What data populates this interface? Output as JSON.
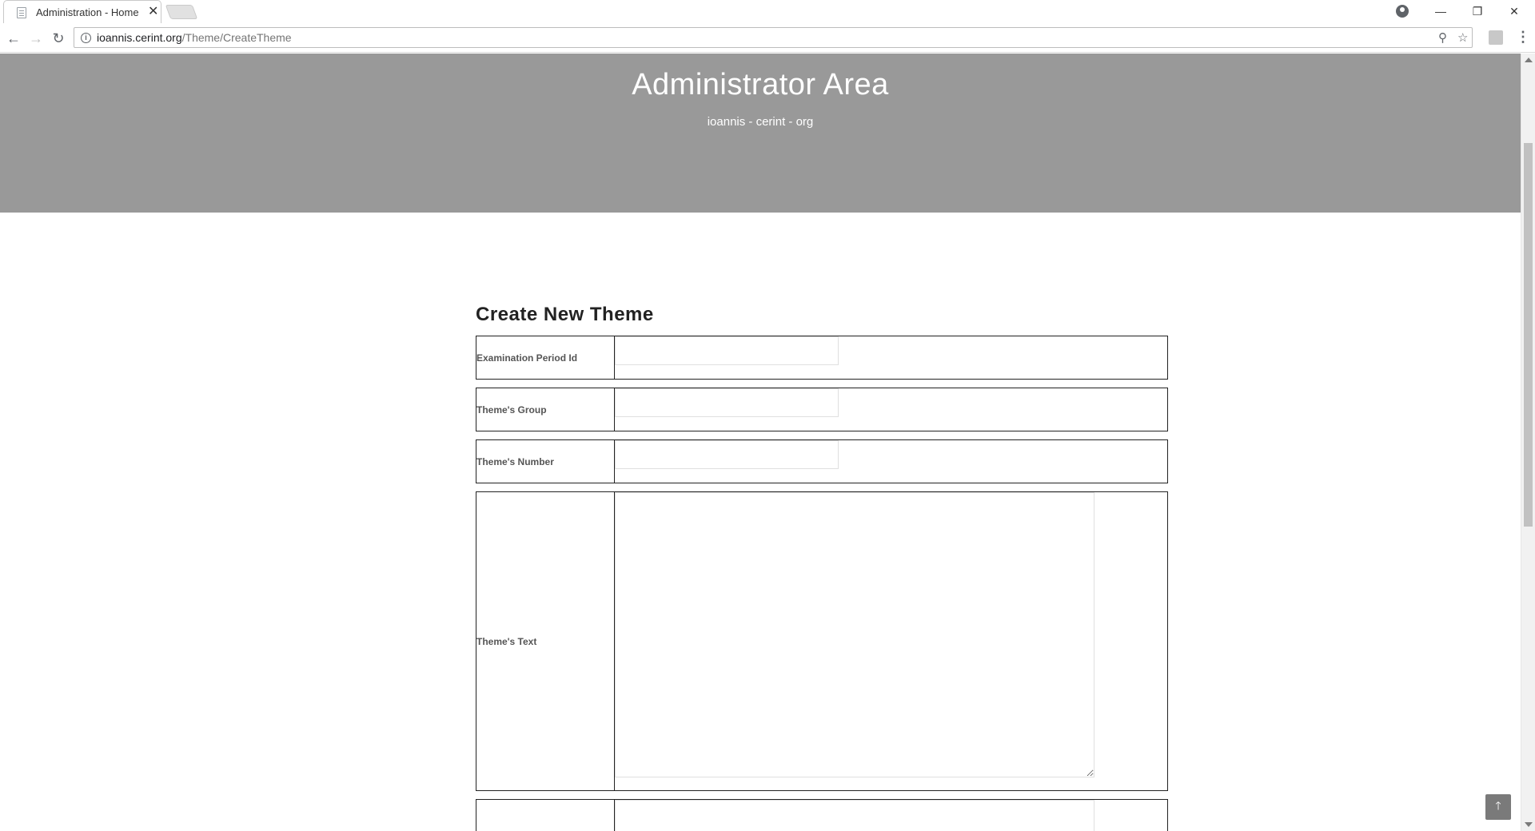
{
  "browser": {
    "tab_title": "Administration - Home -",
    "tab_close": "✕",
    "url_host": "ioannis.cerint.org",
    "url_path": "/Theme/CreateTheme",
    "window_controls": {
      "minimize": "—",
      "restore": "❐",
      "close": "✕"
    },
    "icons": [
      "back-icon",
      "forward-icon",
      "reload-icon",
      "info-icon",
      "zoom-icon",
      "star-icon",
      "profile-icon",
      "menu-icon"
    ]
  },
  "header": {
    "title": "Administrator Area",
    "subtitle": "ioannis - cerint - org"
  },
  "form": {
    "title": "Create New Theme",
    "fields": [
      {
        "label": "Examination Period Id",
        "value": ""
      },
      {
        "label": "Theme's Group",
        "value": ""
      },
      {
        "label": "Theme's Number",
        "value": ""
      },
      {
        "label": "Theme's Text",
        "value": ""
      }
    ]
  },
  "back_to_top": "🡑",
  "colors": {
    "hero_bg": "#999999",
    "hero_text": "#ffffff"
  }
}
